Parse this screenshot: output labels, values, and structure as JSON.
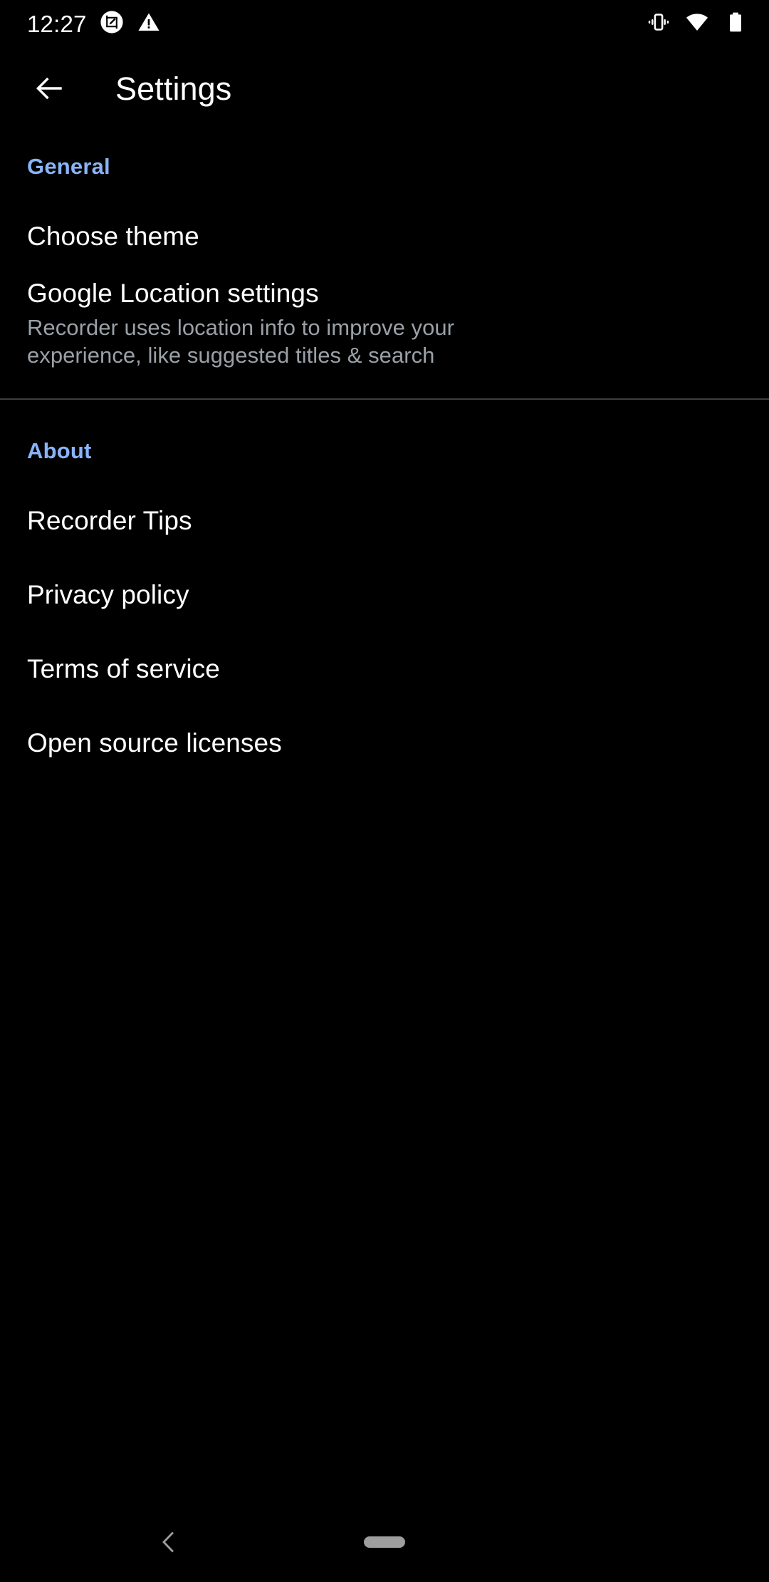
{
  "status_bar": {
    "clock": "12:27",
    "left_icons": [
      {
        "name": "screenshot-markup-icon",
        "glyph": "screenshot-edit"
      },
      {
        "name": "warning-triangle-icon",
        "glyph": "warning"
      }
    ],
    "right_icons": [
      {
        "name": "vibrate-icon",
        "glyph": "vibrate"
      },
      {
        "name": "wifi-icon",
        "glyph": "wifi-full"
      },
      {
        "name": "battery-icon",
        "glyph": "battery-full"
      }
    ]
  },
  "app_bar": {
    "back_label": "Navigate up",
    "title": "Settings"
  },
  "colors": {
    "background": "#000000",
    "section_header": "#8AB4F8",
    "primary_text": "#FFFFFF",
    "secondary_text": "#9AA0A6",
    "divider": "#3C4043",
    "nav_handle": "#9E9E9E"
  },
  "sections": [
    {
      "header": "General",
      "items": [
        {
          "title": "Choose theme",
          "subtitle": ""
        },
        {
          "title": "Google Location settings",
          "subtitle": "Recorder uses location info to improve your experience, like suggested titles & search"
        }
      ]
    },
    {
      "header": "About",
      "items": [
        {
          "title": "Recorder Tips",
          "subtitle": ""
        },
        {
          "title": "Privacy policy",
          "subtitle": ""
        },
        {
          "title": "Terms of service",
          "subtitle": ""
        },
        {
          "title": "Open source licenses",
          "subtitle": ""
        }
      ]
    }
  ],
  "nav_bar": {
    "back_label": "Back",
    "home_label": "Home"
  }
}
